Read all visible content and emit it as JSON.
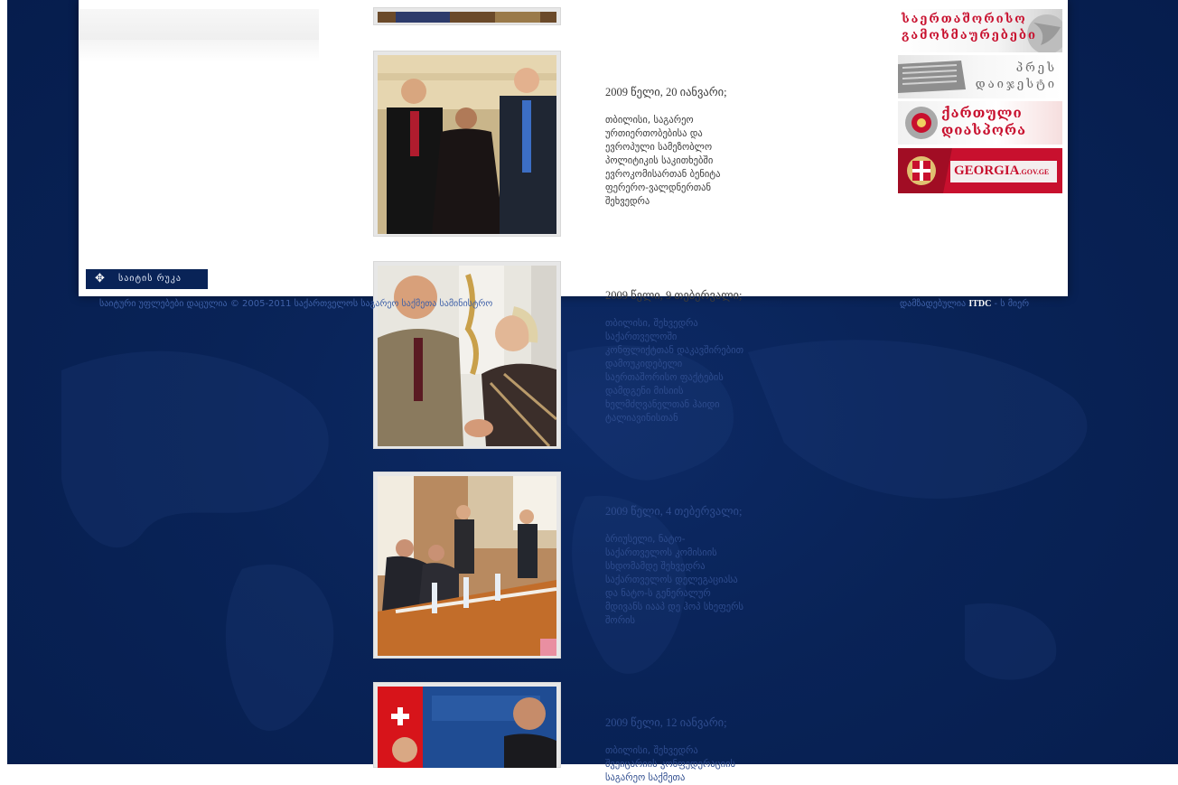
{
  "colors": {
    "page_background": "#092357",
    "panel": "#ffffff",
    "footer_text": "#3f61a8",
    "caption_dark": "#3a3a3a",
    "caption_dim": "#2e4c8e",
    "banner_red": "#c8102e"
  },
  "home_button": {
    "icon": "compass-icon",
    "label": "საიტის რუკა"
  },
  "news": [
    {
      "date": "2009 წელი, 20 იანვარი;",
      "text": "თბილისი, საგარეო\nურთიერთობებისა და\nევროპული სამეზობლო\nპოლიტიკის საკითხებში\nევროკომისართან ბენიტა\nფერერო-ვალდნერთან\nშეხვედრა"
    },
    {
      "date": "2009 წელი, 9 თებერვალი;",
      "text": "თბილისი, შეხვედრა\nსაქართველოში\nკონფლიქტთან დაკავშირებით\nდამოუკიდებელი\nსაერთაშორისო ფაქტების\nდამდგენი მისიის\nხელმძღვანელთან ჰაიდი\nტალიავინისთან"
    },
    {
      "date": "2009 წელი, 4 თებერვალი;",
      "text": "ბრიუსელი, ნატო-\nსაქართველოს კომისიის\nსხდომამდე შეხვედრა\nსაქართველოს დელეგაციასა\nდა ნატო-ს გენერალურ\nმდივანს იააპ დე ჰოპ სხეფერს\nშორის"
    },
    {
      "date": "2009 წელი, 12 იანვარი;",
      "text": "თბილისი, შეხვედრა\nშვეიცარიის კონფედერაციის\nსაგარეო საქმეთა"
    }
  ],
  "banners": [
    {
      "line1": "საერთაშორისო",
      "line2": "გამოხმაურებები"
    },
    {
      "line1": "პრეს",
      "line2": "დაიჯესტი"
    },
    {
      "line1": "ქართული",
      "line2": "დიასპორა"
    },
    {
      "label": "GEORGIA",
      "suffix": ".GOV.GE"
    }
  ],
  "footer": {
    "copyright": "საიტური უფლებები დაცულია © 2005-2011 საქართველოს საგარეო საქმეთა სამინისტრო",
    "developed_prefix": "დამზადებულია",
    "developer": "ITDC",
    "developer_suffix": "- ს მიერ"
  }
}
